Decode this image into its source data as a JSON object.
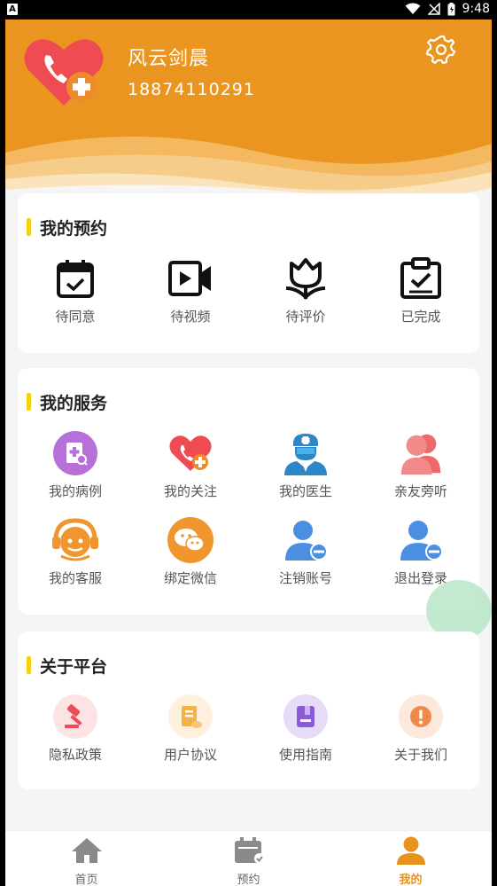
{
  "status_bar": {
    "time": "9:48",
    "app_badge": "A"
  },
  "profile": {
    "name": "风云剑晨",
    "phone": "18874110291"
  },
  "appointments": {
    "title": "我的预约",
    "items": [
      {
        "label": "待同意",
        "icon": "calendar-check-icon"
      },
      {
        "label": "待视频",
        "icon": "video-icon"
      },
      {
        "label": "待评价",
        "icon": "tulip-icon"
      },
      {
        "label": "已完成",
        "icon": "clipboard-check-icon"
      }
    ]
  },
  "services": {
    "title": "我的服务",
    "items": [
      {
        "label": "我的病例",
        "icon": "medical-record-icon"
      },
      {
        "label": "我的关注",
        "icon": "heart-plus-icon"
      },
      {
        "label": "我的医生",
        "icon": "doctor-icon"
      },
      {
        "label": "亲友旁听",
        "icon": "family-icon"
      },
      {
        "label": "我的客服",
        "icon": "customer-service-icon"
      },
      {
        "label": "绑定微信",
        "icon": "wechat-icon"
      },
      {
        "label": "注销账号",
        "icon": "user-remove-icon"
      },
      {
        "label": "退出登录",
        "icon": "logout-user-icon"
      }
    ]
  },
  "platform": {
    "title": "关于平台",
    "items": [
      {
        "label": "隐私政策",
        "icon": "gavel-icon"
      },
      {
        "label": "用户协议",
        "icon": "agreement-icon"
      },
      {
        "label": "使用指南",
        "icon": "guide-book-icon"
      },
      {
        "label": "关于我们",
        "icon": "info-icon"
      }
    ]
  },
  "tabbar": {
    "items": [
      {
        "label": "首页",
        "icon": "home-icon"
      },
      {
        "label": "预约",
        "icon": "calendar-icon"
      },
      {
        "label": "我的",
        "icon": "user-icon",
        "active": true
      }
    ]
  },
  "colors": {
    "brand": "#ea951f",
    "accent_bar": "#f5d20d",
    "active_tab": "#e8921e"
  }
}
